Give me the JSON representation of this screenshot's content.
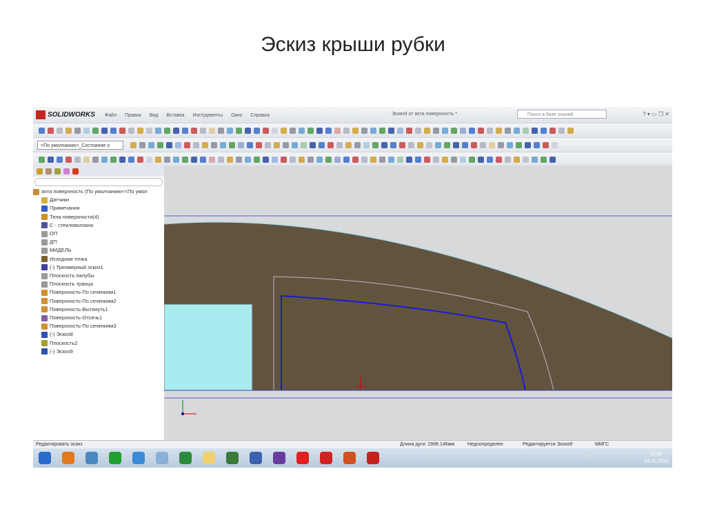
{
  "slide_title": "Эскиз крыши рубки",
  "app": {
    "logo": "SOLIDWORKS",
    "menu": [
      "Файл",
      "Правка",
      "Вид",
      "Вставка",
      "Инструменты",
      "Окно",
      "Справка"
    ],
    "document_title": "Эскиз9 от яхта поверхность *",
    "search_placeholder": "Поиск в базе знаний",
    "config_select": "<По умолчанию>_Состояние о"
  },
  "tree": {
    "root": "яхта поверхность  (По умолчанию<<По умол",
    "items": [
      "Датчики",
      "Примечания",
      "Тела поверхности(4)",
      "С - стекловолокно",
      "ОП",
      "ДП",
      "МИДЕЛЬ",
      "Исходная точка",
      "(-) Трехмерный эскиз1",
      "Плоскость палубы",
      "Плоскость транца",
      "Поверхность-По сечениям1",
      "Поверхность-По сечениям2",
      "Поверхность-Вытянуть1",
      "Поверхность-Отсечь1",
      "Поверхность-По сечениям3",
      "(-) Эскиз8",
      "Плоскость2",
      "(-) Эскиз9"
    ]
  },
  "status": {
    "left": "Редактировать эскиз",
    "arc_length": "Длина дуги: 2998.146мм",
    "state": "Недоопределен",
    "editing": "Редактируется Эскиз9",
    "units": "ММГС"
  },
  "taskbar": {
    "lang": "RU",
    "time": "12:42",
    "date": "09.11.2018"
  },
  "colors": {
    "part": "#62533f",
    "sketch": "#1a1ad0",
    "glass": "#a8ecf0"
  }
}
